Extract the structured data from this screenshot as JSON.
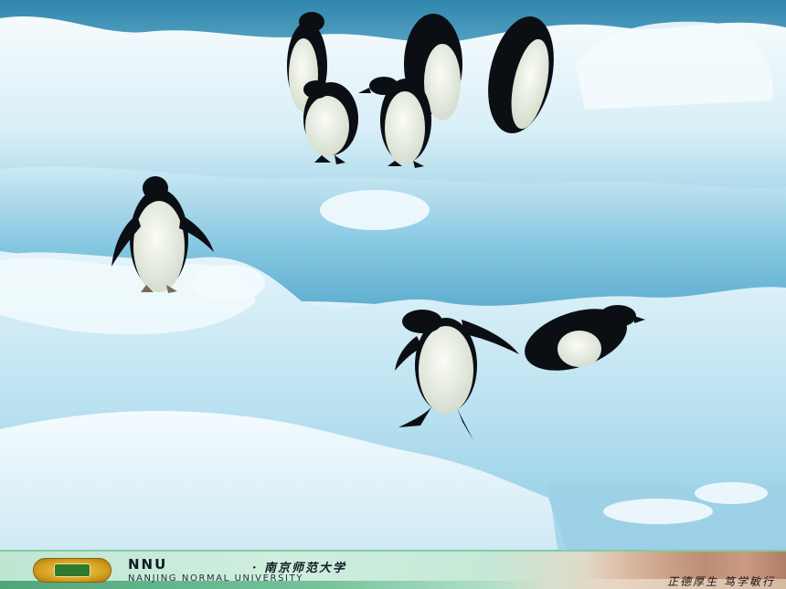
{
  "scene": {
    "subject": "penguins-on-ice",
    "colors": {
      "sky_top": "#3b8fb4",
      "ice_shadow": "#7fc0dd",
      "ice_mid": "#bfe3f1",
      "ice_light": "#eef8fc",
      "penguin_black": "#0b0f14",
      "penguin_white": "#f2f3ec",
      "penguin_belly_shade": "#cfd8c8"
    }
  },
  "footer": {
    "brand": "NNU",
    "brand_cn": "· 南京师范大学",
    "subtitle": "NANJING NORMAL UNIVERSITY",
    "motto": "正德厚生  笃学敏行",
    "colors": {
      "band": "#77c39b",
      "text": "#101a26",
      "logo": "#d6a021"
    }
  }
}
